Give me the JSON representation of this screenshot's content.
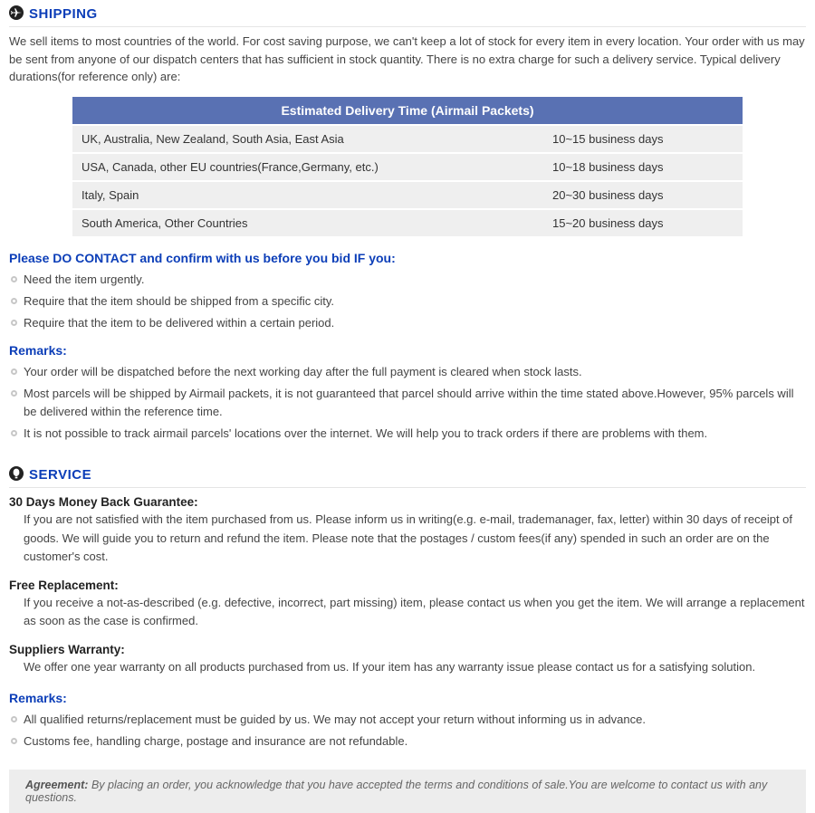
{
  "shipping": {
    "title": "SHIPPING",
    "intro": "We sell items to most countries of the world. For cost saving purpose, we can't keep a lot of stock for every item in every location. Your order with us may be sent from anyone of our dispatch centers that has sufficient in stock quantity. There is no extra charge for such a delivery service. Typical delivery durations(for reference only) are:",
    "table_header": "Estimated Delivery Time (Airmail Packets)",
    "rows": [
      {
        "region": "UK, Australia, New Zealand, South Asia, East Asia",
        "time": "10~15 business days"
      },
      {
        "region": "USA, Canada, other EU countries(France,Germany, etc.)",
        "time": "10~18 business days"
      },
      {
        "region": "Italy, Spain",
        "time": "20~30 business days"
      },
      {
        "region": "South America, Other Countries",
        "time": "15~20 business days"
      }
    ],
    "contact_title": "Please DO CONTACT and confirm with us before you bid IF you:",
    "contact_items": [
      "Need the item urgently.",
      "Require that the item should be shipped from a specific city.",
      "Require that the item to be delivered within a certain period."
    ],
    "remarks_title": "Remarks:",
    "remarks_items": [
      "Your order will be dispatched before the next working day after the full payment is cleared when stock lasts.",
      "Most parcels will be shipped by Airmail packets, it is not guaranteed that parcel should arrive within the time stated above.However, 95% parcels will be delivered within the reference time.",
      "It is not possible to track airmail parcels' locations over the internet. We will help you to track orders if there are problems with them."
    ]
  },
  "service": {
    "title": "SERVICE",
    "blocks": [
      {
        "heading": "30 Days Money Back Guarantee:",
        "body": "If you are not satisfied with the item purchased from us. Please inform us in writing(e.g. e-mail, trademanager, fax, letter) within 30 days of receipt of goods. We will guide you to return and refund the item. Please note that the postages / custom fees(if any) spended in such an order are on the customer's cost."
      },
      {
        "heading": "Free Replacement:",
        "body": "If you receive a not-as-described (e.g. defective, incorrect, part missing) item, please contact us when you get the item. We will arrange a replacement as soon as the case is confirmed."
      },
      {
        "heading": "Suppliers Warranty:",
        "body": "We offer one year warranty on all products purchased from us. If your item has any warranty issue please contact us for a satisfying solution."
      }
    ],
    "remarks_title": "Remarks:",
    "remarks_items": [
      "All qualified returns/replacement must be guided by us. We may not accept your return without informing us in advance.",
      "Customs fee, handling charge, postage and insurance are not refundable."
    ]
  },
  "agreement": {
    "label": "Agreement:",
    "text": " By placing an order, you acknowledge that you have accepted the terms and conditions of sale.You are welcome to contact us with any questions."
  }
}
